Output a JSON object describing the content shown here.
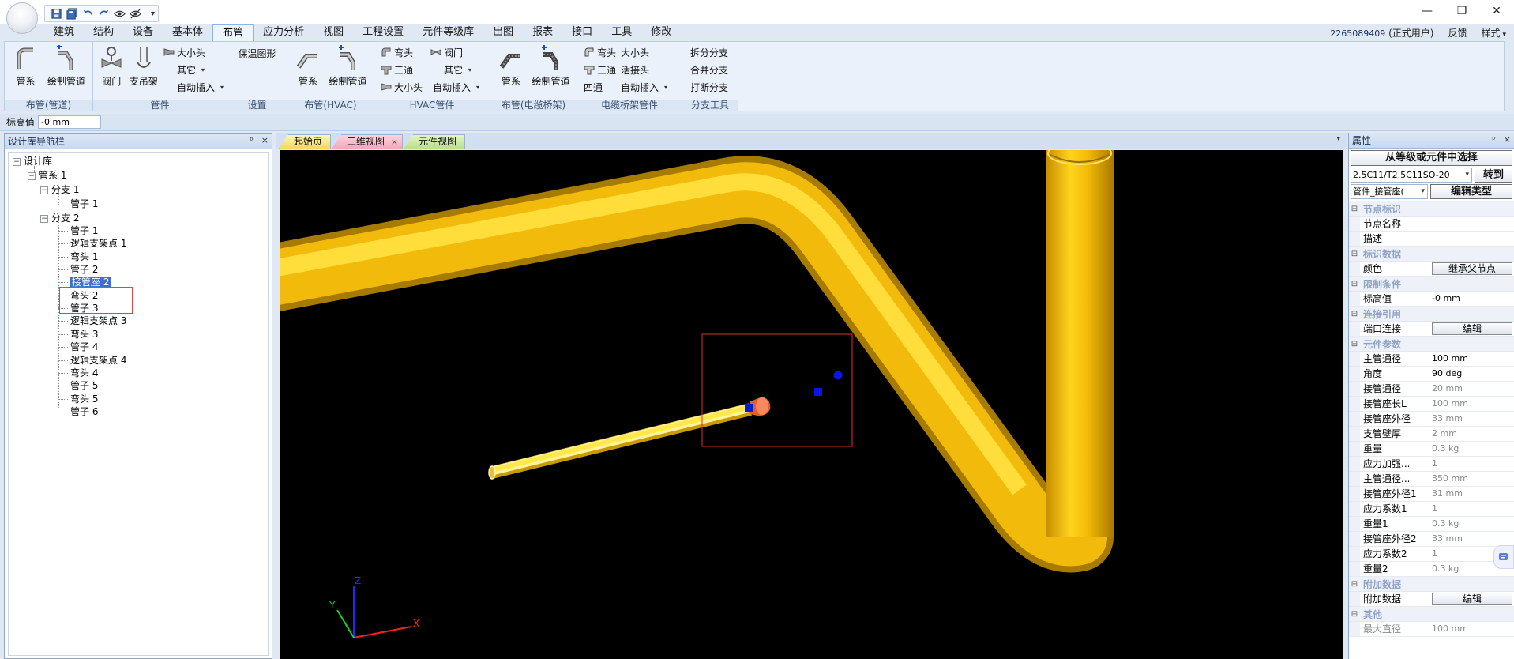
{
  "quick_access": {
    "more": "▾"
  },
  "menu": [
    "建筑",
    "结构",
    "设备",
    "基本体",
    "布管",
    "应力分析",
    "视图",
    "工程设置",
    "元件等级库",
    "出图",
    "报表",
    "接口",
    "工具",
    "修改"
  ],
  "user": {
    "id": "2265089409",
    "role": "(正式用户)",
    "feedback": "反馈",
    "style": "样式",
    "style_dd": "▾"
  },
  "window": {
    "minimize": "—",
    "restore": "❐",
    "close": "✕"
  },
  "ribbon": {
    "g1": {
      "label": "布管(管道)",
      "btn1": "管系",
      "btn2": "绘制管道"
    },
    "g2": {
      "label": "管件",
      "btn1": "阀门",
      "btn2": "支吊架",
      "s1": "大小头",
      "s2": "其它",
      "s3": "自动插入"
    },
    "g3": {
      "label": "设置",
      "s1": "保温图形"
    },
    "g4": {
      "label": "布管(HVAC)",
      "btn1": "管系",
      "btn2": "绘制管道"
    },
    "g5": {
      "label": "HVAC管件",
      "s1": "弯头",
      "s2": "三通",
      "s3": "大小头",
      "s4": "阀门",
      "s5": "其它",
      "s6": "自动插入"
    },
    "g6": {
      "label": "布管(电缆桥架)",
      "btn1": "管系",
      "btn2": "绘制管道"
    },
    "g7": {
      "label": "电缆桥架管件",
      "s1": "弯头",
      "s2": "三通",
      "s3": "四通",
      "s4": "大小头",
      "s5": "活接头",
      "s6": "自动插入"
    },
    "g8": {
      "label": "分支工具",
      "s1": "拆分分支",
      "s2": "合并分支",
      "s3": "打断分支"
    },
    "dropdown_marker": "▾"
  },
  "elevation": {
    "label": "标高值",
    "value": "-0 mm"
  },
  "left_panel": {
    "title": "设计库导航栏",
    "pin": "ᵖ",
    "close": "×"
  },
  "tree": {
    "root": "设计库",
    "system": "管系 1",
    "branch1": "分支 1",
    "b1_items": [
      "管子 1"
    ],
    "branch2": "分支 2",
    "b2_items": [
      "管子 1",
      "逻辑支架点 1",
      "弯头 1",
      "管子 2",
      "接管座 2",
      "弯头 2",
      "管子 3",
      "逻辑支架点 3",
      "弯头 3",
      "管子 4",
      "逻辑支架点 4",
      "弯头 4",
      "管子 5",
      "弯头 5",
      "管子 6"
    ],
    "selected_index": 4,
    "expander": "−"
  },
  "tabs": [
    {
      "label": "起始页"
    },
    {
      "label": "三维视图",
      "close": "×"
    },
    {
      "label": "元件视图"
    }
  ],
  "tabs_dropdown": "▾",
  "viewport": {
    "axes": {
      "x": "X",
      "y": "Y",
      "z": "Z"
    },
    "colors": {
      "pipe": "#f5bf10",
      "pipe_dark": "#b78400",
      "pipe_light": "#ffe04a",
      "background": "#000000",
      "selection": "#e03030",
      "grip": "#0a1ae0",
      "nozzle": "#f07040"
    }
  },
  "properties": {
    "title": "属性",
    "pin": "ᵖ",
    "close": "×",
    "select_button": "从等级或元件中选择",
    "spec_select": "2.5C11/T2.5C11SO-20",
    "goto_button": "转到",
    "type_select": "管件_接管座(",
    "edit_type_button": "编辑类型",
    "dropdown_marker": "▾",
    "expander": "⊟",
    "categories": [
      {
        "name": "节点标识",
        "rows": [
          {
            "k": "节点名称",
            "v": ""
          },
          {
            "k": "描述",
            "v": ""
          }
        ]
      },
      {
        "name": "标识数据",
        "rows": [
          {
            "k": "颜色",
            "v": "继承父节点",
            "btn": true
          }
        ]
      },
      {
        "name": "限制条件",
        "rows": [
          {
            "k": "标高值",
            "v": "-0 mm"
          }
        ]
      },
      {
        "name": "连接引用",
        "rows": [
          {
            "k": "端口连接",
            "v": "编辑",
            "btn": true
          }
        ]
      },
      {
        "name": "元件参数",
        "rows": [
          {
            "k": "主管通径",
            "v": "100 mm"
          },
          {
            "k": "角度",
            "v": "90 deg"
          },
          {
            "k": "接管通径",
            "v": "20 mm",
            "dim": true
          },
          {
            "k": "接管座长L",
            "v": "100 mm",
            "dim": true
          },
          {
            "k": "接管座外径",
            "v": "33 mm",
            "dim": true
          },
          {
            "k": "支管壁厚",
            "v": "2 mm",
            "dim": true
          },
          {
            "k": "重量",
            "v": "0.3 kg",
            "dim": true
          },
          {
            "k": "应力加强...",
            "v": "1",
            "dim": true
          },
          {
            "k": "主管通径...",
            "v": "350 mm",
            "dim": true
          },
          {
            "k": "接管座外径1",
            "v": "31 mm",
            "dim": true
          },
          {
            "k": "应力系数1",
            "v": "1",
            "dim": true
          },
          {
            "k": "重量1",
            "v": "0.3 kg",
            "dim": true
          },
          {
            "k": "接管座外径2",
            "v": "33 mm",
            "dim": true
          },
          {
            "k": "应力系数2",
            "v": "1",
            "dim": true
          },
          {
            "k": "重量2",
            "v": "0.3 kg",
            "dim": true
          }
        ]
      },
      {
        "name": "附加数据",
        "rows": [
          {
            "k": "附加数据",
            "v": "编辑",
            "btn": true
          }
        ]
      },
      {
        "name": "其他",
        "rows": [
          {
            "k": "最大直径",
            "v": "100 mm",
            "dim": true,
            "kdim": true
          }
        ]
      }
    ]
  }
}
